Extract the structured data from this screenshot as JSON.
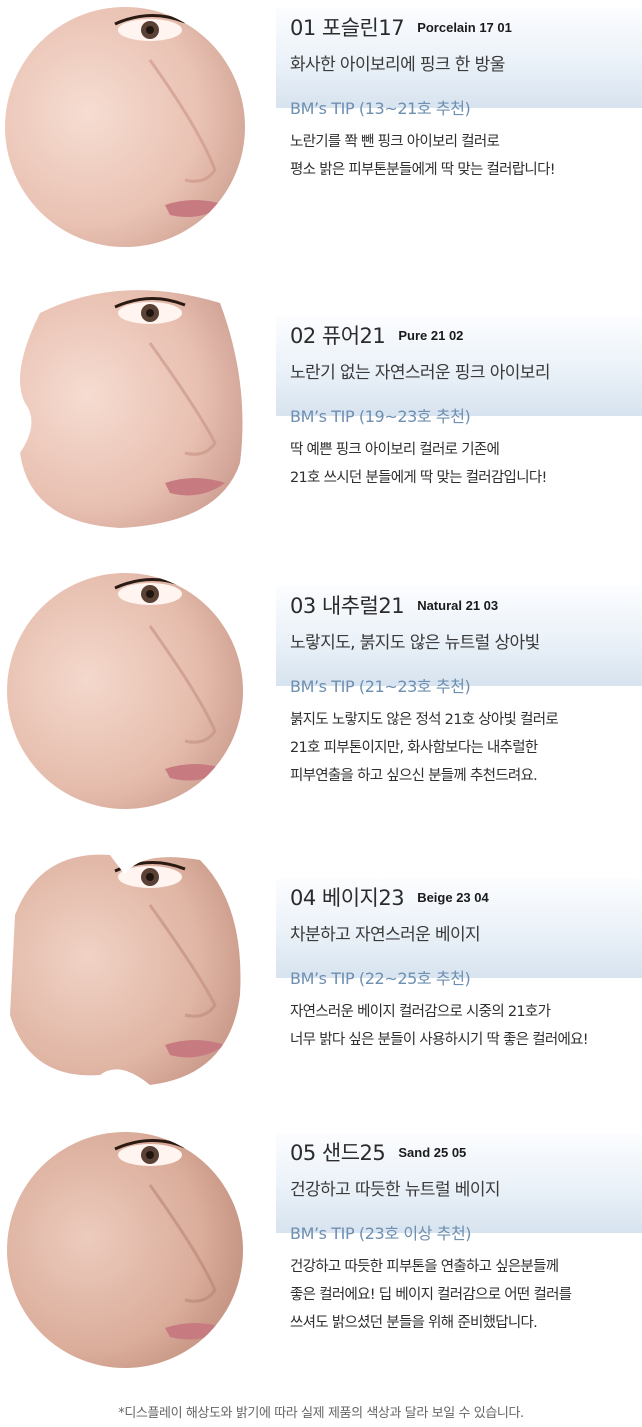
{
  "items": [
    {
      "title": "01 포슬린17",
      "en_label": "Porcelain 17 01",
      "subtitle": "화사한 아이보리에 핑크 한 방울",
      "tip": "BM’s TIP (13~21호 추천)",
      "desc": [
        "노란기를 쫙 뺀 핑크 아이보리 컬러로",
        "평소 밝은 피부톤분들에게 딱 맞는 컬러랍니다!"
      ]
    },
    {
      "title": "02 퓨어21",
      "en_label": "Pure 21 02",
      "subtitle": "노란기 없는 자연스러운 핑크 아이보리",
      "tip": "BM’s TIP (19~23호 추천)",
      "desc": [
        "딱 예쁜 핑크 아이보리 컬러로 기존에",
        "21호 쓰시던 분들에게 딱 맞는 컬러감입니다!"
      ]
    },
    {
      "title": "03 내추럴21",
      "en_label": "Natural 21 03",
      "subtitle": "노랗지도, 붉지도 않은 뉴트럴 상아빛",
      "tip": "BM’s TIP (21~23호 추천)",
      "desc": [
        "붉지도 노랗지도 않은 정석 21호 상아빛 컬러로",
        "21호 피부톤이지만, 화사함보다는 내추럴한",
        "피부연출을 하고 싶으신 분들께 추천드려요."
      ]
    },
    {
      "title": "04 베이지23",
      "en_label": "Beige 23 04",
      "subtitle": "차분하고 자연스러운 베이지",
      "tip": "BM’s TIP (22~25호 추천)",
      "desc": [
        "자연스러운 베이지 컬러감으로 시중의 21호가",
        "너무 밝다 싶은 분들이 사용하시기 딱 좋은 컬러에요!"
      ]
    },
    {
      "title": "05 샌드25",
      "en_label": "Sand 25 05",
      "subtitle": "건강하고 따듯한 뉴트럴 베이지",
      "tip": "BM’s TIP (23호 이상 추천)",
      "desc": [
        "건강하고 따듯한 피부톤을 연출하고 싶은분들께",
        "좋은 컬러에요! 딥 베이지 컬러감으로 어떤 컬러를",
        "쓰셔도 밝으셨던 분들을 위해 준비했답니다."
      ]
    }
  ],
  "footnote": "*디스플레이 해상도와 밝기에 따라 실제 제품의 색상과 달라 보일 수 있습니다.",
  "colors": {
    "tip": "#6e8fb0",
    "panel_top": "#fcfdff",
    "panel_bottom": "#d7e3ef",
    "skin_light": "#f3d8cc",
    "skin_shadow": "#c9998b",
    "lip": "#c77a80"
  }
}
